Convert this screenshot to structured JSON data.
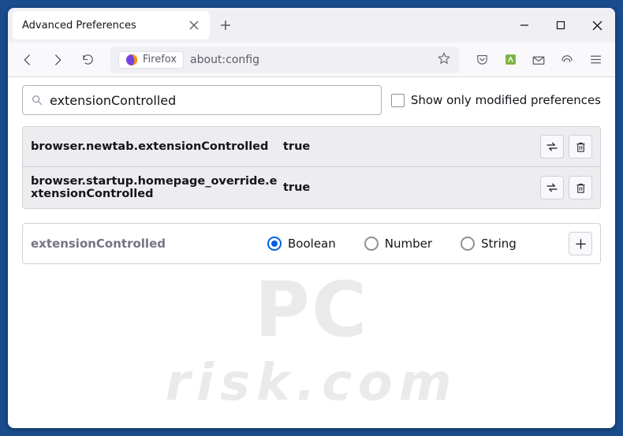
{
  "tab": {
    "title": "Advanced Preferences"
  },
  "navbar": {
    "identity_label": "Firefox",
    "url": "about:config"
  },
  "search": {
    "value": "extensionControlled",
    "checkbox_label": "Show only modified preferences"
  },
  "prefs": [
    {
      "name": "browser.newtab.extensionControlled",
      "value": "true"
    },
    {
      "name": "browser.startup.homepage_override.extensionControlled",
      "value": "true"
    }
  ],
  "create": {
    "name": "extensionControlled",
    "types": {
      "boolean": "Boolean",
      "number": "Number",
      "string": "String"
    }
  },
  "watermark": {
    "line1": "PC",
    "line2": "risk.com"
  }
}
